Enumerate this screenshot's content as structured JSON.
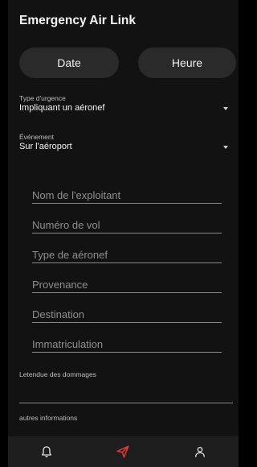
{
  "app": {
    "title": "Emergency Air Link"
  },
  "buttons": {
    "date_label": "Date",
    "hour_label": "Heure"
  },
  "emergency_type": {
    "label": "Type d'urgence",
    "value": "Impliquant un aéronef"
  },
  "event": {
    "label": "Événement",
    "value": "Sur l'aéroport"
  },
  "fields": {
    "operator": "Nom de l'exploitant",
    "flight_number": "Numéro de vol",
    "aircraft_type": "Type de aéronef",
    "origin": "Provenance",
    "destination": "Destination",
    "registration": "Immatriculation"
  },
  "damage": {
    "label": "Letendue des dommages"
  },
  "other_info": {
    "label": "autres informations"
  },
  "nav": {
    "items": [
      "bell-icon",
      "send-icon",
      "person-icon"
    ],
    "accent": "#e53935"
  },
  "colors": {
    "background": "#121212",
    "button": "#2a2a2a",
    "accent": "#e53935"
  }
}
